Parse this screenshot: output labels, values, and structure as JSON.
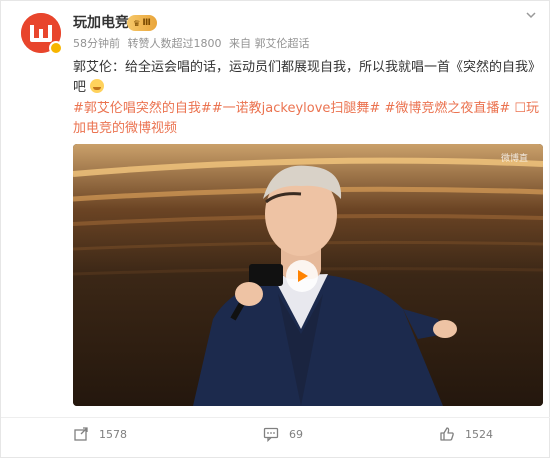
{
  "author": {
    "name": "玩加电竞",
    "badge": "Ⅲ"
  },
  "meta": {
    "time": "58分钟前",
    "reposts_note": "转赞人数超过1800",
    "source": "来自 郭艾伦超话"
  },
  "post": {
    "text": "郭艾伦：给全运会唱的话，运动员们都展现自我，所以我就唱一首《突然的自我》吧",
    "topics": "#郭艾伦唱突然的自我##一诺教jackeylove扫腿舞# #微博竞燃之夜直播# ☐玩加电竞的微博视频"
  },
  "video": {
    "watermark": "微博直"
  },
  "actions": {
    "repost_count": "1578",
    "comment_count": "69",
    "like_count": "1524"
  },
  "colors": {
    "topic": "#eb7350",
    "avatar": "#e8452c"
  }
}
